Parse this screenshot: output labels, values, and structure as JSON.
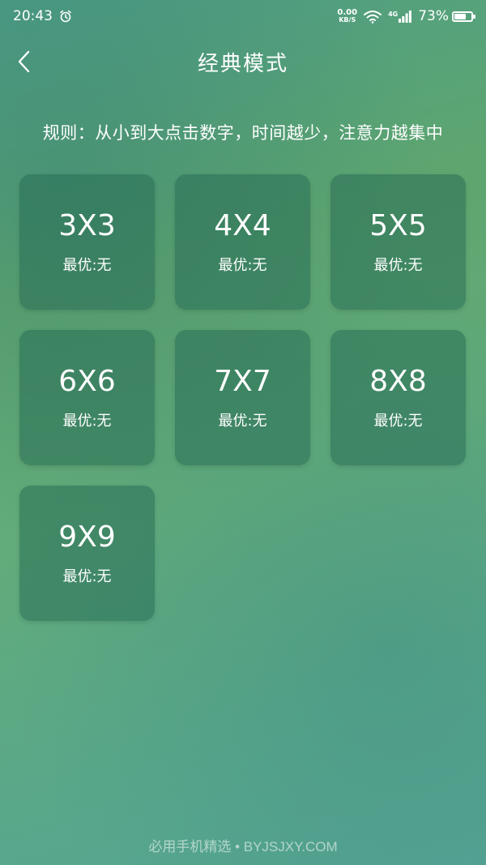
{
  "status_bar": {
    "time": "20:43",
    "net_speed_value": "0.00",
    "net_speed_unit": "KB/S",
    "network_type": "4G",
    "battery_percent": "73%",
    "battery_level": 0.73,
    "icons": [
      "alarm-icon",
      "wifi-icon",
      "signal-icon",
      "battery-icon"
    ]
  },
  "header": {
    "title": "经典模式",
    "back_icon": "chevron-left-icon"
  },
  "rules": {
    "text": "规则：从小到大点击数字，时间越少，注意力越集中"
  },
  "modes": [
    {
      "size": "3X3",
      "best_label": "最优:无"
    },
    {
      "size": "4X4",
      "best_label": "最优:无"
    },
    {
      "size": "5X5",
      "best_label": "最优:无"
    },
    {
      "size": "6X6",
      "best_label": "最优:无"
    },
    {
      "size": "7X7",
      "best_label": "最优:无"
    },
    {
      "size": "8X8",
      "best_label": "最优:无"
    },
    {
      "size": "9X9",
      "best_label": "最优:无"
    }
  ],
  "watermark": {
    "text": "必用手机精选 • BYJSJXY.COM"
  },
  "colors": {
    "background": "#5ea66f",
    "card": "#3f7f5f",
    "text": "#ffffff"
  }
}
